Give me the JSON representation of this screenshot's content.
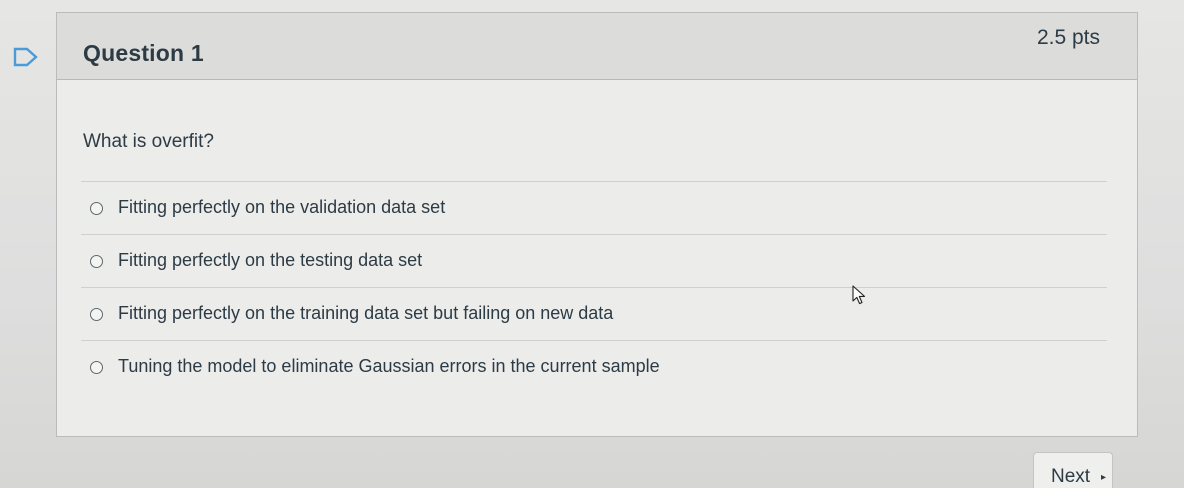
{
  "question": {
    "title": "Question 1",
    "points": "2.5 pts",
    "text": "What is overfit?"
  },
  "answers": [
    {
      "label": "Fitting perfectly on the validation data set",
      "selected": false
    },
    {
      "label": "Fitting perfectly on the testing data set",
      "selected": false
    },
    {
      "label": "Fitting perfectly on the training data set but failing on new data",
      "selected": false
    },
    {
      "label": "Tuning the model to eliminate Gaussian errors in the current sample",
      "selected": false
    }
  ],
  "navigation": {
    "next_label": "Next",
    "next_arrow": "▸"
  },
  "icons": {
    "flag": "flag-question-icon",
    "cursor": "mouse-pointer-icon"
  },
  "colors": {
    "text": "#2d3b45",
    "flag": "#4a9bd8"
  }
}
